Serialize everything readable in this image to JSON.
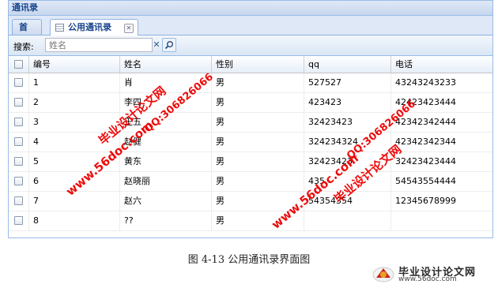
{
  "window": {
    "title": "通讯录"
  },
  "tabs": [
    {
      "label": "首页",
      "active": false
    },
    {
      "label": "公用通讯录",
      "active": true
    }
  ],
  "search": {
    "label": "搜索:",
    "placeholder": "姓名",
    "value": ""
  },
  "grid": {
    "columns": [
      "编号",
      "姓名",
      "性别",
      "qq",
      "电话"
    ],
    "rows": [
      {
        "id": "1",
        "name": "肖",
        "gender": "男",
        "qq": "527527",
        "phone": "43243243233"
      },
      {
        "id": "2",
        "name": "李四",
        "gender": "男",
        "qq": "423423",
        "phone": "42423423444"
      },
      {
        "id": "3",
        "name": "王五",
        "gender": "男",
        "qq": "32423423",
        "phone": "42342342444"
      },
      {
        "id": "4",
        "name": "赵健",
        "gender": "男",
        "qq": "324234324",
        "phone": "42342342344"
      },
      {
        "id": "5",
        "name": "黄东",
        "gender": "男",
        "qq": "32423423",
        "phone": "32423423444"
      },
      {
        "id": "6",
        "name": "赵晓丽",
        "gender": "男",
        "qq": "435",
        "phone": "54543554444"
      },
      {
        "id": "7",
        "name": "赵六",
        "gender": "男",
        "qq": "54354354",
        "phone": "12345678999"
      },
      {
        "id": "8",
        "name": "??",
        "gender": "男",
        "qq": "",
        "phone": ""
      }
    ]
  },
  "caption": "图 4-13   公用通讯录界面图",
  "watermark": {
    "site": "www.56doc.com",
    "title": "毕业设计论文网",
    "qq": "QQ:306826066"
  },
  "logo": {
    "title": "毕业设计论文网",
    "url": "www.56doc.com"
  },
  "colors": {
    "accent": "#15428b",
    "border": "#99bbe8",
    "watermark": "#e00000"
  }
}
